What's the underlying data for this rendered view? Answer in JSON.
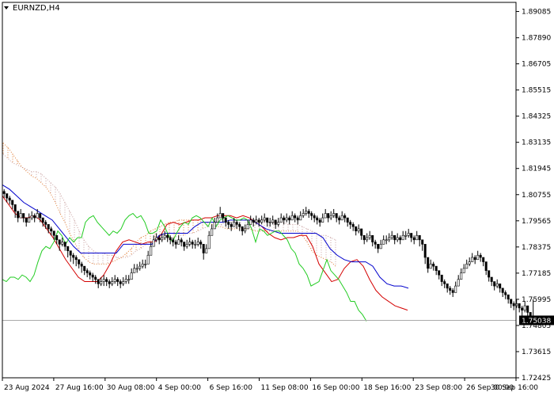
{
  "chart_data": {
    "type": "line",
    "title": "EURNZD,H4",
    "xlabel": "",
    "ylabel": "",
    "ylim": [
      1.72425,
      1.895
    ],
    "x_tick_labels": [
      "23 Aug 2024",
      "27 Aug 16:00",
      "30 Aug 08:00",
      "4 Sep 00:00",
      "6 Sep 16:00",
      "11 Sep 08:00",
      "16 Sep 00:00",
      "18 Sep 16:00",
      "23 Sep 08:00",
      "26 Sep 00:00",
      "30 Sep 16:00"
    ],
    "y_tick_labels": [
      "1.89085",
      "1.87890",
      "1.86705",
      "1.85515",
      "1.84325",
      "1.83135",
      "1.81945",
      "1.80755",
      "1.79565",
      "1.78375",
      "1.77185",
      "1.75995",
      "1.74805",
      "1.73615",
      "1.72425"
    ],
    "current_price": "1.75038",
    "current_price_value": 1.75038,
    "grid": false,
    "colors": {
      "bull_candle": "#000000",
      "bear_candle": "#000000",
      "tenkan": "#d40000",
      "kijun": "#0000cc",
      "chikou": "#22cc22",
      "kumo_bull": "#e07a30",
      "kumo_bear": "#c8a0a0",
      "price_line": "#aaaaaa",
      "price_tag": "#000000"
    },
    "series": [
      {
        "type": "candles",
        "step": 3.5,
        "close": [
          1.808,
          1.806,
          1.805,
          1.803,
          1.8,
          1.797,
          1.799,
          1.797,
          1.795,
          1.797,
          1.798,
          1.797,
          1.799,
          1.797,
          1.795,
          1.794,
          1.792,
          1.791,
          1.789,
          1.787,
          1.785,
          1.786,
          1.784,
          1.782,
          1.78,
          1.779,
          1.778,
          1.776,
          1.775,
          1.773,
          1.772,
          1.771,
          1.77,
          1.769,
          1.767,
          1.768,
          1.769,
          1.768,
          1.767,
          1.768,
          1.769,
          1.768,
          1.767,
          1.768,
          1.769,
          1.769,
          1.772,
          1.774,
          1.774,
          1.775,
          1.776,
          1.776,
          1.78,
          1.784,
          1.787,
          1.788,
          1.787,
          1.788,
          1.789,
          1.788,
          1.787,
          1.786,
          1.785,
          1.787,
          1.786,
          1.784,
          1.785,
          1.786,
          1.785,
          1.785,
          1.786,
          1.785,
          1.781,
          1.783,
          1.789,
          1.792,
          1.795,
          1.797,
          1.799,
          1.797,
          1.795,
          1.794,
          1.793,
          1.795,
          1.794,
          1.793,
          1.791,
          1.792,
          1.794,
          1.796,
          1.795,
          1.796,
          1.795,
          1.796,
          1.797,
          1.795,
          1.795,
          1.796,
          1.794,
          1.795,
          1.797,
          1.796,
          1.797,
          1.796,
          1.798,
          1.797,
          1.796,
          1.798,
          1.799,
          1.8,
          1.799,
          1.798,
          1.797,
          1.796,
          1.795,
          1.797,
          1.799,
          1.797,
          1.798,
          1.799,
          1.797,
          1.796,
          1.798,
          1.797,
          1.795,
          1.794,
          1.793,
          1.791,
          1.792,
          1.789,
          1.787,
          1.788,
          1.789,
          1.786,
          1.785,
          1.783,
          1.785,
          1.787,
          1.787,
          1.788,
          1.789,
          1.787,
          1.788,
          1.787,
          1.789,
          1.789,
          1.79,
          1.788,
          1.787,
          1.789,
          1.787,
          1.785,
          1.779,
          1.774,
          1.776,
          1.775,
          1.773,
          1.771,
          1.768,
          1.767,
          1.765,
          1.764,
          1.763,
          1.766,
          1.769,
          1.772,
          1.774,
          1.776,
          1.777,
          1.779,
          1.778,
          1.78,
          1.779,
          1.777,
          1.773,
          1.77,
          1.768,
          1.766,
          1.767,
          1.765,
          1.763,
          1.762,
          1.76,
          1.758,
          1.757,
          1.758,
          1.756,
          1.755,
          1.757,
          1.754,
          1.752,
          1.751
        ],
        "low": [
          1.806,
          1.804,
          1.803,
          1.801,
          1.797,
          1.795,
          1.797,
          1.795,
          1.793,
          1.795,
          1.796,
          1.795,
          1.797,
          1.795,
          1.793,
          1.792,
          1.79,
          1.789,
          1.787,
          1.785,
          1.782,
          1.784,
          1.782,
          1.779,
          1.777,
          1.776,
          1.775,
          1.774,
          1.772,
          1.771,
          1.77,
          1.769,
          1.768,
          1.767,
          1.765,
          1.766,
          1.766,
          1.766,
          1.765,
          1.766,
          1.767,
          1.766,
          1.765,
          1.766,
          1.767,
          1.767,
          1.77,
          1.772,
          1.772,
          1.773,
          1.774,
          1.774,
          1.778,
          1.782,
          1.785,
          1.786,
          1.785,
          1.786,
          1.787,
          1.786,
          1.785,
          1.784,
          1.783,
          1.785,
          1.784,
          1.782,
          1.783,
          1.784,
          1.783,
          1.783,
          1.784,
          1.783,
          1.778,
          1.781,
          1.787,
          1.79,
          1.793,
          1.795,
          1.797,
          1.795,
          1.793,
          1.792,
          1.791,
          1.793,
          1.792,
          1.791,
          1.789,
          1.79,
          1.792,
          1.794,
          1.793,
          1.794,
          1.793,
          1.794,
          1.795,
          1.793,
          1.793,
          1.794,
          1.792,
          1.793,
          1.795,
          1.794,
          1.795,
          1.794,
          1.796,
          1.795,
          1.794,
          1.796,
          1.797,
          1.798,
          1.797,
          1.796,
          1.795,
          1.794,
          1.793,
          1.795,
          1.797,
          1.795,
          1.796,
          1.797,
          1.795,
          1.794,
          1.796,
          1.795,
          1.793,
          1.792,
          1.791,
          1.789,
          1.79,
          1.787,
          1.785,
          1.786,
          1.787,
          1.784,
          1.783,
          1.781,
          1.783,
          1.785,
          1.785,
          1.786,
          1.787,
          1.785,
          1.786,
          1.785,
          1.787,
          1.787,
          1.788,
          1.786,
          1.785,
          1.787,
          1.784,
          1.782,
          1.776,
          1.772,
          1.774,
          1.773,
          1.771,
          1.769,
          1.766,
          1.765,
          1.763,
          1.762,
          1.761,
          1.764,
          1.767,
          1.77,
          1.772,
          1.774,
          1.775,
          1.777,
          1.776,
          1.778,
          1.777,
          1.775,
          1.771,
          1.768,
          1.766,
          1.764,
          1.765,
          1.763,
          1.761,
          1.76,
          1.758,
          1.756,
          1.755,
          1.756,
          1.754,
          1.752,
          1.754,
          1.751,
          1.749,
          1.749
        ],
        "high": [
          1.81,
          1.808,
          1.807,
          1.805,
          1.802,
          1.799,
          1.801,
          1.799,
          1.797,
          1.799,
          1.8,
          1.799,
          1.801,
          1.799,
          1.797,
          1.796,
          1.794,
          1.793,
          1.791,
          1.789,
          1.787,
          1.788,
          1.786,
          1.784,
          1.782,
          1.781,
          1.78,
          1.778,
          1.777,
          1.775,
          1.774,
          1.773,
          1.772,
          1.771,
          1.769,
          1.77,
          1.771,
          1.77,
          1.769,
          1.77,
          1.771,
          1.77,
          1.769,
          1.77,
          1.771,
          1.771,
          1.774,
          1.776,
          1.776,
          1.777,
          1.778,
          1.778,
          1.782,
          1.786,
          1.789,
          1.79,
          1.789,
          1.79,
          1.791,
          1.79,
          1.789,
          1.788,
          1.787,
          1.789,
          1.788,
          1.786,
          1.787,
          1.788,
          1.787,
          1.787,
          1.788,
          1.787,
          1.784,
          1.785,
          1.791,
          1.794,
          1.797,
          1.799,
          1.802,
          1.799,
          1.797,
          1.796,
          1.795,
          1.797,
          1.796,
          1.795,
          1.793,
          1.794,
          1.796,
          1.798,
          1.797,
          1.798,
          1.797,
          1.798,
          1.799,
          1.797,
          1.797,
          1.798,
          1.796,
          1.797,
          1.799,
          1.798,
          1.799,
          1.798,
          1.8,
          1.799,
          1.798,
          1.8,
          1.801,
          1.802,
          1.801,
          1.8,
          1.799,
          1.798,
          1.797,
          1.799,
          1.801,
          1.799,
          1.8,
          1.801,
          1.799,
          1.798,
          1.8,
          1.799,
          1.797,
          1.796,
          1.795,
          1.793,
          1.794,
          1.791,
          1.789,
          1.79,
          1.791,
          1.788,
          1.787,
          1.785,
          1.787,
          1.789,
          1.789,
          1.79,
          1.791,
          1.789,
          1.79,
          1.789,
          1.791,
          1.791,
          1.792,
          1.79,
          1.789,
          1.791,
          1.789,
          1.787,
          1.782,
          1.776,
          1.778,
          1.777,
          1.775,
          1.773,
          1.77,
          1.769,
          1.767,
          1.766,
          1.765,
          1.768,
          1.771,
          1.774,
          1.776,
          1.778,
          1.779,
          1.781,
          1.78,
          1.782,
          1.781,
          1.779,
          1.775,
          1.772,
          1.77,
          1.768,
          1.769,
          1.767,
          1.765,
          1.764,
          1.762,
          1.76,
          1.759,
          1.76,
          1.758,
          1.757,
          1.759,
          1.756,
          1.754,
          1.76
        ]
      },
      {
        "name": "",
        "type": "line",
        "color_key": "tenkan",
        "step": 8,
        "values": [
          1.807,
          1.803,
          1.799,
          1.797,
          1.797,
          1.798,
          1.796,
          1.792,
          1.788,
          1.783,
          1.778,
          1.774,
          1.77,
          1.768,
          1.768,
          1.768,
          1.771,
          1.776,
          1.782,
          1.786,
          1.787,
          1.786,
          1.785,
          1.786,
          1.786,
          1.789,
          1.794,
          1.795,
          1.794,
          1.795,
          1.796,
          1.796,
          1.797,
          1.797,
          1.798,
          1.798,
          1.798,
          1.797,
          1.798,
          1.797,
          1.795,
          1.793,
          1.79,
          1.788,
          1.787,
          1.788,
          1.788,
          1.789,
          1.789,
          1.784,
          1.776,
          1.772,
          1.768,
          1.769,
          1.774,
          1.777,
          1.778,
          1.775,
          1.769,
          1.764,
          1.761,
          1.759,
          1.757,
          1.756,
          1.755
        ]
      },
      {
        "name": "",
        "type": "line",
        "color_key": "kijun",
        "step": 9,
        "values": [
          1.812,
          1.81,
          1.807,
          1.804,
          1.802,
          1.8,
          1.798,
          1.796,
          1.792,
          1.788,
          1.784,
          1.781,
          1.781,
          1.781,
          1.781,
          1.781,
          1.781,
          1.785,
          1.785,
          1.785,
          1.785,
          1.785,
          1.789,
          1.79,
          1.79,
          1.79,
          1.79,
          1.793,
          1.795,
          1.795,
          1.795,
          1.795,
          1.796,
          1.796,
          1.796,
          1.796,
          1.794,
          1.792,
          1.791,
          1.79,
          1.79,
          1.79,
          1.79,
          1.79,
          1.79,
          1.788,
          1.783,
          1.78,
          1.778,
          1.777,
          1.777,
          1.777,
          1.775,
          1.77,
          1.767,
          1.766,
          1.766,
          1.765
        ]
      },
      {
        "name": "",
        "type": "line",
        "color_key": "chikou",
        "step": 5,
        "values": [
          1.769,
          1.768,
          1.77,
          1.77,
          1.769,
          1.771,
          1.77,
          1.768,
          1.771,
          1.777,
          1.782,
          1.784,
          1.783,
          1.786,
          1.791,
          1.789,
          1.785,
          1.788,
          1.786,
          1.788,
          1.788,
          1.795,
          1.797,
          1.798,
          1.795,
          1.793,
          1.791,
          1.789,
          1.791,
          1.79,
          1.792,
          1.796,
          1.798,
          1.799,
          1.797,
          1.798,
          1.795,
          1.79,
          1.79,
          1.791,
          1.796,
          1.793,
          1.789,
          1.786,
          1.79,
          1.793,
          1.795,
          1.794,
          1.797,
          1.798,
          1.797,
          1.795,
          1.793,
          1.797,
          1.793,
          1.796,
          1.797,
          1.798,
          1.797,
          1.796,
          1.796,
          1.797,
          1.796,
          1.792,
          1.786,
          1.792,
          1.791,
          1.789,
          1.79,
          1.791,
          1.791,
          1.789,
          1.787,
          1.783,
          1.781,
          1.776,
          1.774,
          1.771,
          1.766,
          1.767,
          1.768,
          1.773,
          1.778,
          1.773,
          1.771,
          1.769,
          1.766,
          1.763,
          1.759,
          1.759,
          1.755,
          1.753,
          1.75
        ]
      },
      {
        "name": "",
        "type": "cloud",
        "step": 6,
        "span_a": [
          1.831,
          1.829,
          1.826,
          1.823,
          1.82,
          1.818,
          1.816,
          1.815,
          1.813,
          1.811,
          1.808,
          1.804,
          1.799,
          1.795,
          1.79,
          1.786,
          1.782,
          1.779,
          1.777,
          1.776,
          1.776,
          1.776,
          1.776,
          1.777,
          1.778,
          1.779,
          1.781,
          1.783,
          1.786,
          1.788,
          1.789,
          1.791,
          1.792,
          1.793,
          1.794,
          1.795,
          1.795,
          1.796,
          1.796,
          1.796,
          1.796,
          1.796,
          1.795,
          1.795,
          1.794,
          1.793,
          1.793,
          1.792,
          1.792,
          1.792,
          1.792,
          1.792,
          1.792,
          1.791,
          1.791,
          1.791,
          1.791,
          1.791,
          1.791,
          1.791,
          1.791,
          1.791,
          1.791,
          1.789,
          1.786,
          1.782,
          1.78,
          1.779,
          1.778,
          1.777,
          1.775
        ],
        "span_b": [
          1.826,
          1.824,
          1.822,
          1.821,
          1.82,
          1.819,
          1.818,
          1.818,
          1.817,
          1.815,
          1.813,
          1.811,
          1.808,
          1.804,
          1.8,
          1.796,
          1.791,
          1.787,
          1.784,
          1.782,
          1.781,
          1.781,
          1.78,
          1.78,
          1.779,
          1.779,
          1.779,
          1.78,
          1.782,
          1.783,
          1.785,
          1.786,
          1.786,
          1.787,
          1.787,
          1.788,
          1.788,
          1.789,
          1.789,
          1.79,
          1.79,
          1.791,
          1.792,
          1.793,
          1.793,
          1.794,
          1.794,
          1.795,
          1.795,
          1.796,
          1.796,
          1.796,
          1.796,
          1.796,
          1.796,
          1.796,
          1.795,
          1.795,
          1.795,
          1.795,
          1.794,
          1.794,
          1.794,
          1.793,
          1.792,
          1.791,
          1.79,
          1.789,
          1.789,
          1.788,
          1.787
        ]
      }
    ]
  }
}
